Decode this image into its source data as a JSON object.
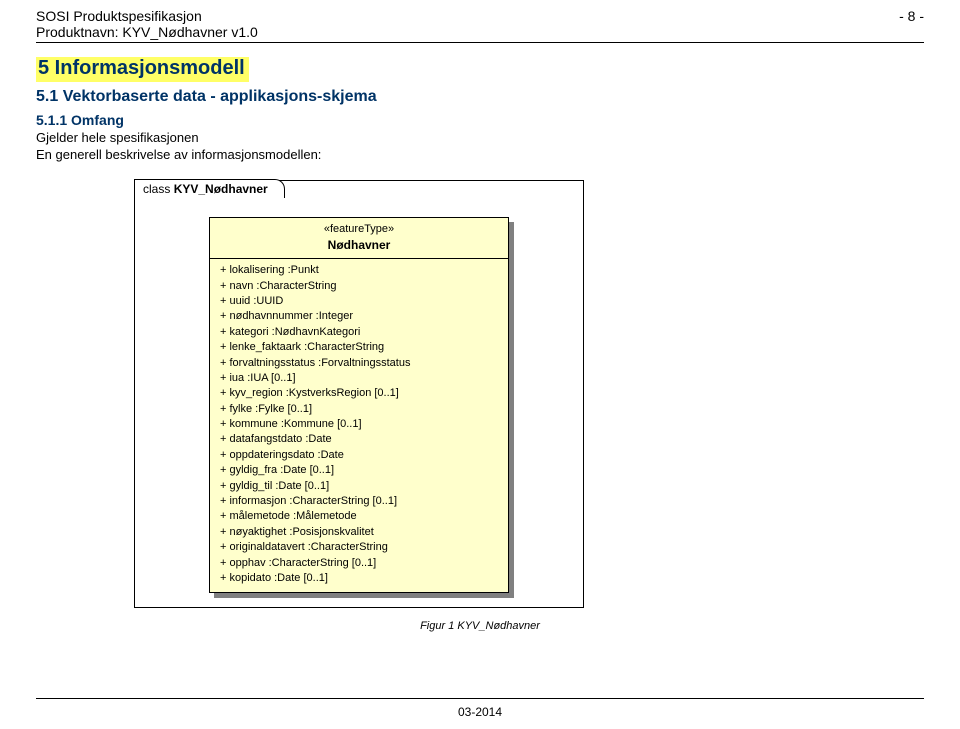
{
  "header": {
    "title": "SOSI Produktspesifikasjon",
    "product": "Produktnavn: KYV_Nødhavner v1.0",
    "page": "- 8 -"
  },
  "section": {
    "title": "5 Informasjonsmodell",
    "sub1": "5.1 Vektorbaserte data - applikasjons-skjema",
    "sub2": "5.1.1 Omfang",
    "p1": "Gjelder hele spesifikasjonen",
    "p2": "En generell beskrivelse av informasjonsmodellen:"
  },
  "uml": {
    "tab_prefix": "class ",
    "tab_name": "KYV_Nødhavner",
    "stereotype": "«featureType»",
    "classname": "Nødhavner",
    "attrs": [
      "+   lokalisering  :Punkt",
      "+   navn  :CharacterString",
      "+   uuid  :UUID",
      "+   nødhavnnummer  :Integer",
      "+   kategori  :NødhavnKategori",
      "+   lenke_faktaark  :CharacterString",
      "+   forvaltningsstatus  :Forvaltningsstatus",
      "+   iua  :IUA [0..1]",
      "+   kyv_region  :KystverksRegion [0..1]",
      "+   fylke  :Fylke [0..1]",
      "+   kommune  :Kommune [0..1]",
      "+   datafangstdato  :Date",
      "+   oppdateringsdato  :Date",
      "+   gyldig_fra  :Date [0..1]",
      "+   gyldig_til  :Date [0..1]",
      "+   informasjon  :CharacterString [0..1]",
      "+   målemetode  :Målemetode",
      "+   nøyaktighet  :Posisjonskvalitet",
      "+   originaldatavert  :CharacterString",
      "+   opphav  :CharacterString [0..1]",
      "+   kopidato  :Date [0..1]"
    ]
  },
  "caption": "Figur 1 KYV_Nødhavner",
  "footer": "03-2014"
}
